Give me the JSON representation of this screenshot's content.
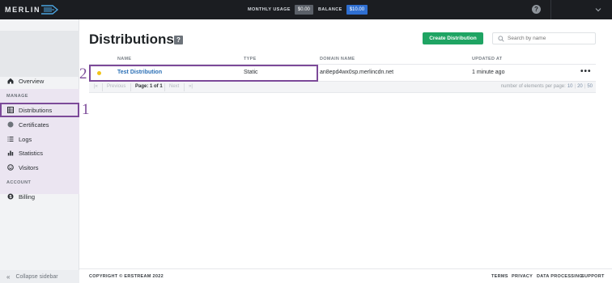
{
  "topbar": {
    "logo_text": "MERLIN",
    "monthly_usage_label": "MONTHLY USAGE",
    "monthly_usage_value": "$0.00",
    "balance_label": "BALANCE",
    "balance_value": "$10.00",
    "help_icon": "question-circle-icon",
    "user_menu_icon": "chevron-down-icon"
  },
  "sidebar": {
    "overview": "Overview",
    "manage_section": "MANAGE",
    "items": [
      {
        "label": "Distributions",
        "icon": "grid-icon"
      },
      {
        "label": "Certificates",
        "icon": "shield-icon"
      },
      {
        "label": "Logs",
        "icon": "list-icon"
      },
      {
        "label": "Statistics",
        "icon": "bar-chart-icon"
      },
      {
        "label": "Visitors",
        "icon": "smile-icon"
      }
    ],
    "account_section": "ACCOUNT",
    "billing": "Billing",
    "collapse": "Collapse sidebar"
  },
  "annotations": {
    "marker_1": "1",
    "marker_2": "2"
  },
  "main": {
    "title": "Distributions",
    "title_help": "?",
    "create_button": "Create Distribution",
    "search_placeholder": "Search by name",
    "columns": [
      "NAME",
      "TYPE",
      "DOMAIN NAME",
      "UPDATED AT"
    ],
    "rows": [
      {
        "status_color": "#f2c418",
        "name": "Test Distribution",
        "type": "Static",
        "domain": "an8epd4wx0sp.merlincdn.net",
        "updated": "1 minute ago",
        "actions": "•••"
      }
    ],
    "pagination": {
      "first": "|«",
      "previous": "Previous",
      "page": "Page: 1 of 1",
      "next": "Next",
      "last": "»|",
      "per_page_label": "number of elements per page:",
      "per_page_options": [
        "10",
        "20",
        "50"
      ],
      "separator": "|"
    }
  },
  "footer": {
    "copyright": "COPYRIGHT © ERSTREAM 2022",
    "links": [
      "TERMS",
      "PRIVACY",
      "DATA PROCESSING",
      "SUPPORT"
    ]
  }
}
